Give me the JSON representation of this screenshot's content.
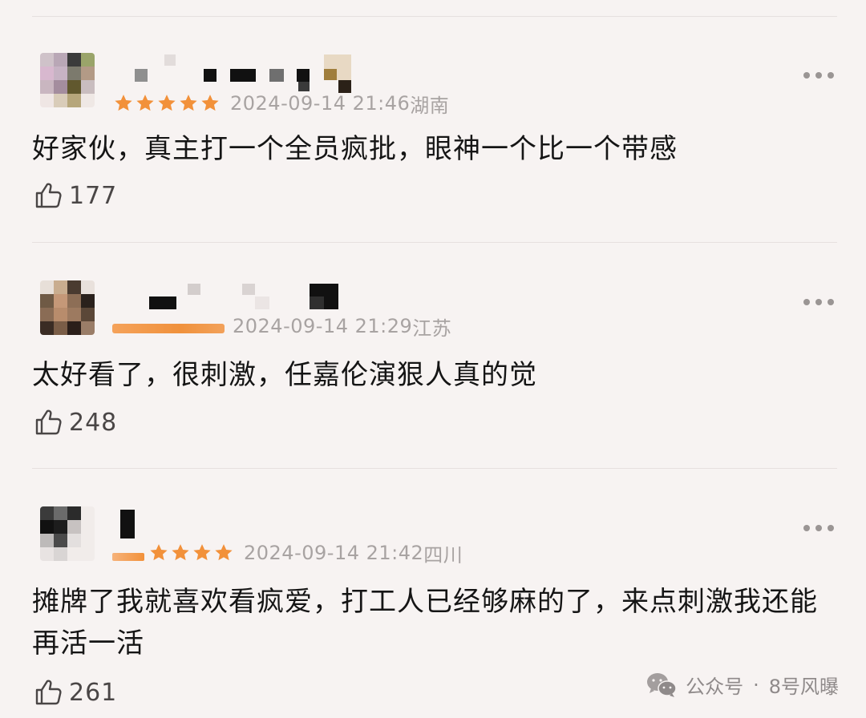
{
  "comments": [
    {
      "date": "2024-09-14 21:46",
      "location": "湖南",
      "rating": 5,
      "text": "好家伙，真主打一个全员疯批，眼神一个比一个带感",
      "likes": "177"
    },
    {
      "date": "2024-09-14 21:29",
      "location": "江苏",
      "text": "太好看了，很刺激，任嘉伦演狠人真的觉",
      "likes": "248"
    },
    {
      "date": "2024-09-14 21:42",
      "location": "四川",
      "rating": 5,
      "text": "摊牌了我就喜欢看疯爱，打工人已经够麻的了，来点刺激我还能再活一活",
      "likes": "261"
    }
  ],
  "watermark": {
    "label": "公众号",
    "separator": "·",
    "account": "8号风曝"
  },
  "colors": {
    "background": "#f7f3f2",
    "star": "#f2913a",
    "meta_text": "#a8a3a2",
    "divider": "#e6e0df"
  },
  "icons": [
    "thumbs-up-icon",
    "more-options-icon",
    "star-icon",
    "wechat-icon"
  ]
}
